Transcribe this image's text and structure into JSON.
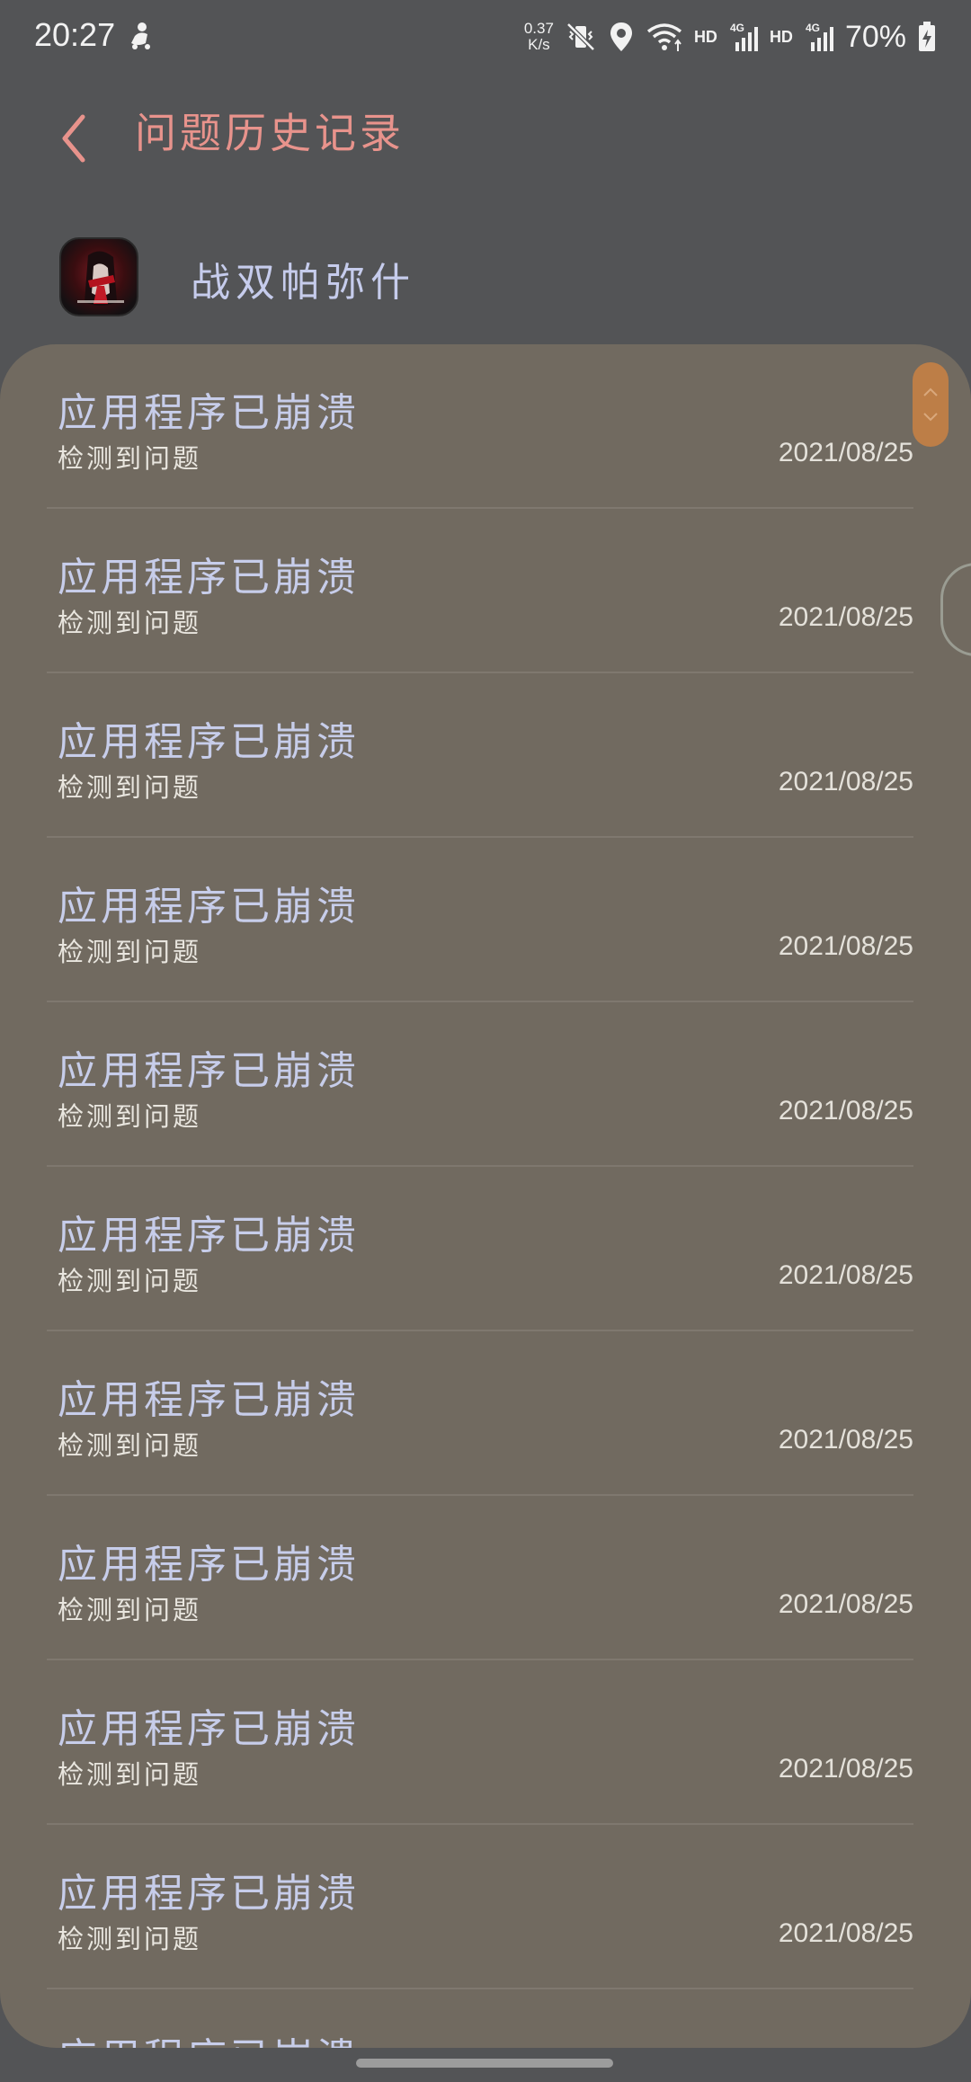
{
  "status": {
    "time": "20:27",
    "net_speed_value": "0.37",
    "net_speed_unit": "K/s",
    "hd1": "HD",
    "hd2": "HD",
    "battery": "70%"
  },
  "appbar": {
    "title": "问题历史记录",
    "back_icon": "chevron-left-icon"
  },
  "app": {
    "name": "战双帕弥什",
    "icon": "app-icon"
  },
  "list": {
    "items": [
      {
        "title": "应用程序已崩溃",
        "subtitle": "检测到问题",
        "date": "2021/08/25"
      },
      {
        "title": "应用程序已崩溃",
        "subtitle": "检测到问题",
        "date": "2021/08/25"
      },
      {
        "title": "应用程序已崩溃",
        "subtitle": "检测到问题",
        "date": "2021/08/25"
      },
      {
        "title": "应用程序已崩溃",
        "subtitle": "检测到问题",
        "date": "2021/08/25"
      },
      {
        "title": "应用程序已崩溃",
        "subtitle": "检测到问题",
        "date": "2021/08/25"
      },
      {
        "title": "应用程序已崩溃",
        "subtitle": "检测到问题",
        "date": "2021/08/25"
      },
      {
        "title": "应用程序已崩溃",
        "subtitle": "检测到问题",
        "date": "2021/08/25"
      },
      {
        "title": "应用程序已崩溃",
        "subtitle": "检测到问题",
        "date": "2021/08/25"
      },
      {
        "title": "应用程序已崩溃",
        "subtitle": "检测到问题",
        "date": "2021/08/25"
      },
      {
        "title": "应用程序已崩溃",
        "subtitle": "检测到问题",
        "date": "2021/08/25"
      },
      {
        "title": "应用程序已崩溃",
        "subtitle": "",
        "date": ""
      }
    ]
  },
  "colors": {
    "background": "#535456",
    "panel": "#716a60",
    "title_accent": "#e8938c",
    "item_title": "#c7cdea",
    "scroll_handle": "#bd7e47"
  }
}
